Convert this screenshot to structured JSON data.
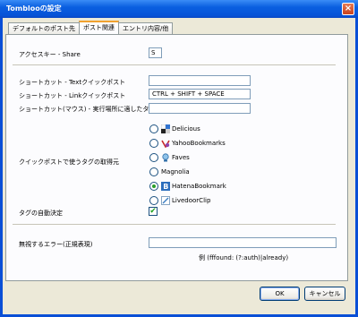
{
  "window": {
    "title": "Tomblooの設定",
    "close_label": "×"
  },
  "tabs": [
    {
      "label": "デフォルトのポスト先"
    },
    {
      "label": "ポスト関連"
    },
    {
      "label": "エントリ内容/他"
    }
  ],
  "accesskey": {
    "label": "アクセスキー - Share",
    "value": "S"
  },
  "shortcuts": {
    "text_label": "ショートカット - Textクイックポスト",
    "text_value": "",
    "link_label": "ショートカット - Linkクイックポスト",
    "link_value": "CTRL + SHIFT + SPACE",
    "mouse_label": "ショートカット(マウス) - 実行場所に適したタイプ",
    "mouse_value": ""
  },
  "tag_source": {
    "label": "クイックポストで使うタグの取得元",
    "selected": "HatenaBookmark",
    "options": [
      {
        "label": "Delicious",
        "icon": "delicious-icon"
      },
      {
        "label": "YahooBookmarks",
        "icon": "yahoo-bookmarks-icon"
      },
      {
        "label": "Faves",
        "icon": "faves-icon"
      },
      {
        "label": "Magnolia",
        "icon": ""
      },
      {
        "label": "HatenaBookmark",
        "icon": "hatena-icon"
      },
      {
        "label": "LivedoorClip",
        "icon": "livedoor-clip-icon"
      }
    ]
  },
  "auto_tag": {
    "label": "タグの自動決定",
    "checked": true,
    "mark": "✔"
  },
  "ignore_errors": {
    "label": "無視するエラー(正規表現)",
    "value": "",
    "example": "例 (fffound: (?:auth)|already)"
  },
  "buttons": {
    "ok": "OK",
    "cancel": "キャンセル"
  },
  "colors": {
    "titlebar": "#0a5fe0",
    "dialog_bg": "#ece9d8",
    "tab_accent": "#f1a22f",
    "radio_dot": "#2a9d2a"
  }
}
